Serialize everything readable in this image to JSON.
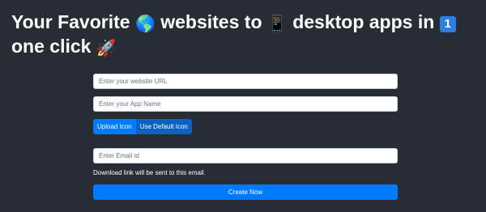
{
  "header": {
    "title_part1": "Your Favorite",
    "globe_emoji": "🌎",
    "title_part2": "websites to",
    "phone_emoji": "📱",
    "title_part3": "desktop apps in",
    "keycap_one": "1",
    "title_part4": "one click",
    "rocket_emoji": "🚀"
  },
  "form": {
    "url_placeholder": "Enter your website URL",
    "url_value": "",
    "app_name_placeholder": "Enter your App Name",
    "app_name_value": "",
    "upload_icon_label": "Upload Icon",
    "default_icon_label": "Use Default Icon",
    "email_placeholder": "Enter Email id",
    "email_value": "",
    "email_hint": "Download link will be sent to this email.",
    "create_label": "Create Now"
  },
  "colors": {
    "background": "#282c34",
    "primary": "#007bff",
    "secondary_button": "#0b62c6"
  }
}
